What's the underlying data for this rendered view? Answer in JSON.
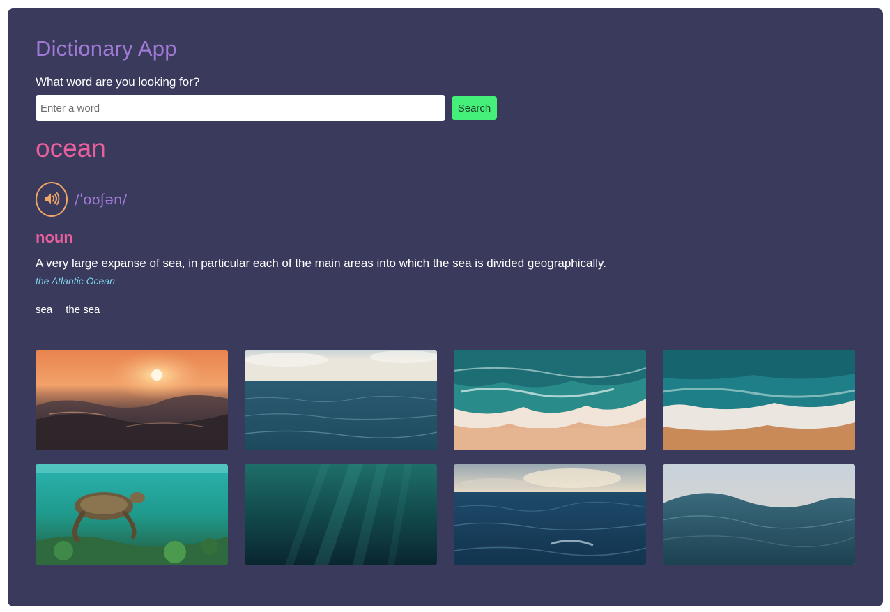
{
  "app": {
    "title": "Dictionary App"
  },
  "search": {
    "prompt": "What word are you looking for?",
    "placeholder": "Enter a word",
    "value": "",
    "button_label": "Search"
  },
  "result": {
    "word": "ocean",
    "phonetic": "/ˈoʊʃən/",
    "audio_icon": "speaker-icon",
    "meanings": [
      {
        "part_of_speech": "noun",
        "definition": "A very large expanse of sea, in particular each of the main areas into which the sea is divided geographically.",
        "example": "the Atlantic Ocean",
        "synonyms": [
          "sea",
          "the sea"
        ]
      }
    ]
  },
  "colors": {
    "background": "#3a3a5c",
    "title": "#a07ad6",
    "word": "#e7609d",
    "search_button": "#44f07a",
    "audio_ring": "#f1a765",
    "example": "#7fd8f0"
  },
  "gallery": {
    "photos": [
      "sunset-over-waves-photo",
      "open-sea-horizon-photo",
      "aerial-waves-on-beach-photo",
      "aerial-shoreline-foam-photo",
      "sea-turtle-underwater-photo",
      "deep-underwater-light-rays-photo",
      "choppy-sea-under-clouds-photo",
      "close-up-calm-wave-photo"
    ]
  }
}
